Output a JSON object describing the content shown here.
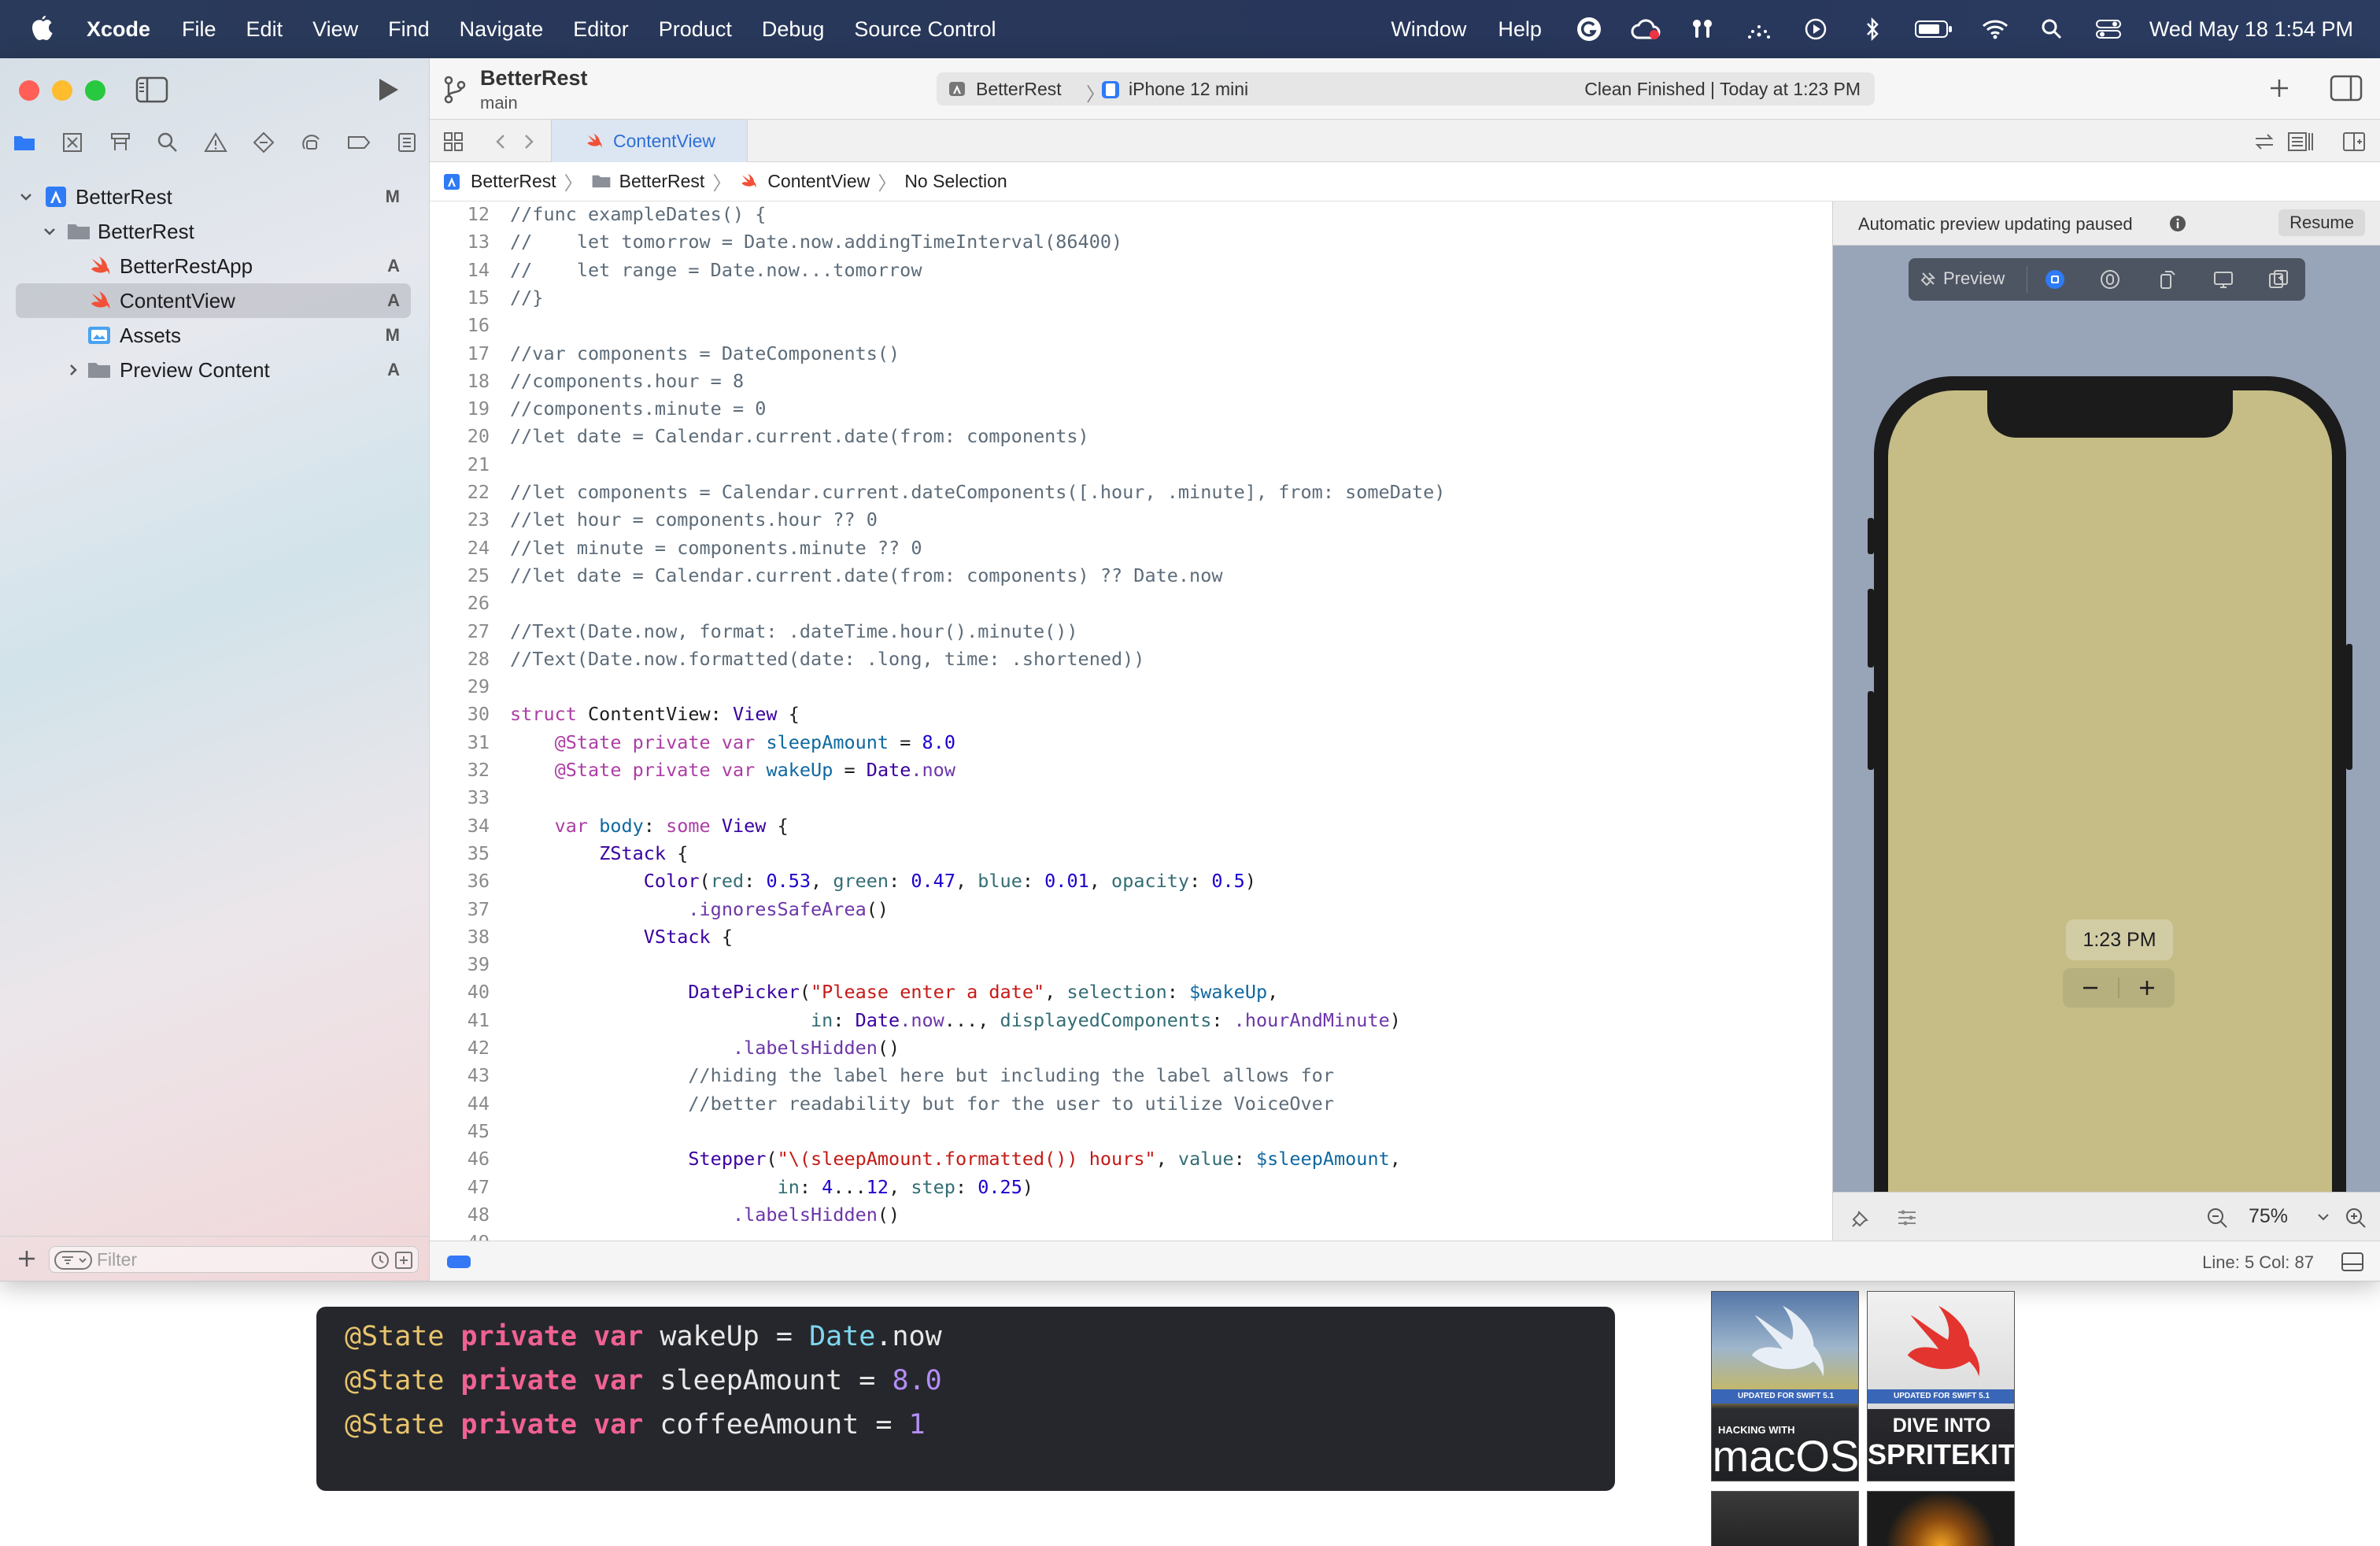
{
  "menubar": {
    "app_name": "Xcode",
    "items": [
      "File",
      "Edit",
      "View",
      "Find",
      "Navigate",
      "Editor",
      "Product",
      "Debug",
      "Source Control"
    ],
    "right_items": [
      "Window",
      "Help"
    ],
    "status_icons": [
      "grammarly-icon",
      "creative-cloud-icon",
      "airpods-icon",
      "wifi-dots-icon",
      "play-icon",
      "bluetooth-icon",
      "battery-icon",
      "wifi-icon",
      "search-icon",
      "control-center-icon"
    ],
    "clock": "Wed May 18  1:54 PM"
  },
  "window": {
    "toolbar": {
      "project": "BetterRest",
      "branch": "main",
      "activity": {
        "scheme": "BetterRest",
        "device": "iPhone 12 mini",
        "status": "Clean Finished | Today at 1:23 PM"
      }
    },
    "navigator": {
      "tree": [
        {
          "label": "BetterRest",
          "badge": "M",
          "type": "project"
        },
        {
          "label": "BetterRest",
          "badge": "",
          "type": "folder"
        },
        {
          "label": "BetterRestApp",
          "badge": "A",
          "type": "swift"
        },
        {
          "label": "ContentView",
          "badge": "A",
          "type": "swift",
          "selected": true
        },
        {
          "label": "Assets",
          "badge": "M",
          "type": "assets"
        },
        {
          "label": "Preview Content",
          "badge": "A",
          "type": "folder"
        }
      ],
      "filter_placeholder": "Filter"
    },
    "tab": {
      "label": "ContentView"
    },
    "jumpbar": [
      "BetterRest",
      "BetterRest",
      "ContentView",
      "No Selection"
    ],
    "editor": {
      "lines": [
        {
          "n": "12",
          "code": "//func exampleDates() {"
        },
        {
          "n": "13",
          "code": "//    let tomorrow = Date.now.addingTimeInterval(86400)"
        },
        {
          "n": "14",
          "code": "//    let range = Date.now...tomorrow"
        },
        {
          "n": "15",
          "code": "//}"
        },
        {
          "n": "16",
          "code": ""
        },
        {
          "n": "17",
          "code": "//var components = DateComponents()"
        },
        {
          "n": "18",
          "code": "//components.hour = 8"
        },
        {
          "n": "19",
          "code": "//components.minute = 0"
        },
        {
          "n": "20",
          "code": "//let date = Calendar.current.date(from: components)"
        },
        {
          "n": "21",
          "code": ""
        },
        {
          "n": "22",
          "code": "//let components = Calendar.current.dateComponents([.hour, .minute], from: someDate)"
        },
        {
          "n": "23",
          "code": "//let hour = components.hour ?? 0"
        },
        {
          "n": "24",
          "code": "//let minute = components.minute ?? 0"
        },
        {
          "n": "25",
          "code": "//let date = Calendar.current.date(from: components) ?? Date.now"
        },
        {
          "n": "26",
          "code": ""
        },
        {
          "n": "27",
          "code": "//Text(Date.now, format: .dateTime.hour().minute())"
        },
        {
          "n": "28",
          "code": "//Text(Date.now.formatted(date: .long, time: .shortened))"
        },
        {
          "n": "29",
          "code": ""
        },
        {
          "n": "30",
          "code": "struct ContentView: View {"
        },
        {
          "n": "31",
          "code": "    @State private var sleepAmount = 8.0"
        },
        {
          "n": "32",
          "code": "    @State private var wakeUp = Date.now"
        },
        {
          "n": "33",
          "code": ""
        },
        {
          "n": "34",
          "code": "    var body: some View {"
        },
        {
          "n": "35",
          "code": "        ZStack {"
        },
        {
          "n": "36",
          "code": "            Color(red: 0.53, green: 0.47, blue: 0.01, opacity: 0.5)"
        },
        {
          "n": "37",
          "code": "                .ignoresSafeArea()"
        },
        {
          "n": "38",
          "code": "            VStack {"
        },
        {
          "n": "39",
          "code": ""
        },
        {
          "n": "40",
          "code": "                DatePicker(\"Please enter a date\", selection: $wakeUp,"
        },
        {
          "n": "41",
          "code": "                           in: Date.now..., displayedComponents: .hourAndMinute)"
        },
        {
          "n": "42",
          "code": "                    .labelsHidden()"
        },
        {
          "n": "43",
          "code": "                //hiding the label here but including the label allows for"
        },
        {
          "n": "44",
          "code": "                //better readability but for the user to utilize VoiceOver"
        },
        {
          "n": "45",
          "code": ""
        },
        {
          "n": "46",
          "code": "                Stepper(\"\\(sleepAmount.formatted()) hours\", value: $sleepAmount,"
        },
        {
          "n": "47",
          "code": "                        in: 4...12, step: 0.25)"
        },
        {
          "n": "48",
          "code": "                    .labelsHidden()"
        },
        {
          "n": "49",
          "code": ""
        }
      ]
    },
    "preview": {
      "message": "Automatic preview updating paused",
      "resume_label": "Resume",
      "preview_label": "Preview",
      "time_value": "1:23 PM",
      "minus_label": "−",
      "plus_label": "+",
      "zoom": "75%",
      "background_color": "#c5bd85"
    },
    "debugbar": {
      "position": "Line: 5  Col: 87"
    }
  },
  "background_page": {
    "code_lines": [
      {
        "at": "@State",
        "kw1": "private",
        "kw2": "var",
        "name": "wakeUp",
        "eq": "=",
        "val_type": "Date",
        "val_rest": ".now",
        "num": ""
      },
      {
        "at": "@State",
        "kw1": "private",
        "kw2": "var",
        "name": "sleepAmount",
        "eq": "=",
        "val_type": "",
        "val_rest": "",
        "num": "8.0"
      },
      {
        "at": "@State",
        "kw1": "private",
        "kw2": "var",
        "name": "coffeeAmount",
        "eq": "=",
        "val_type": "",
        "val_rest": "",
        "num": "1"
      }
    ],
    "books": [
      {
        "ribbon": "UPDATED FOR SWIFT 5.1",
        "sub": "HACKING WITH",
        "title": "macOS"
      },
      {
        "ribbon": "UPDATED FOR SWIFT 5.1",
        "title1": "DIVE INTO",
        "title2": "SPRITEKIT"
      }
    ]
  }
}
